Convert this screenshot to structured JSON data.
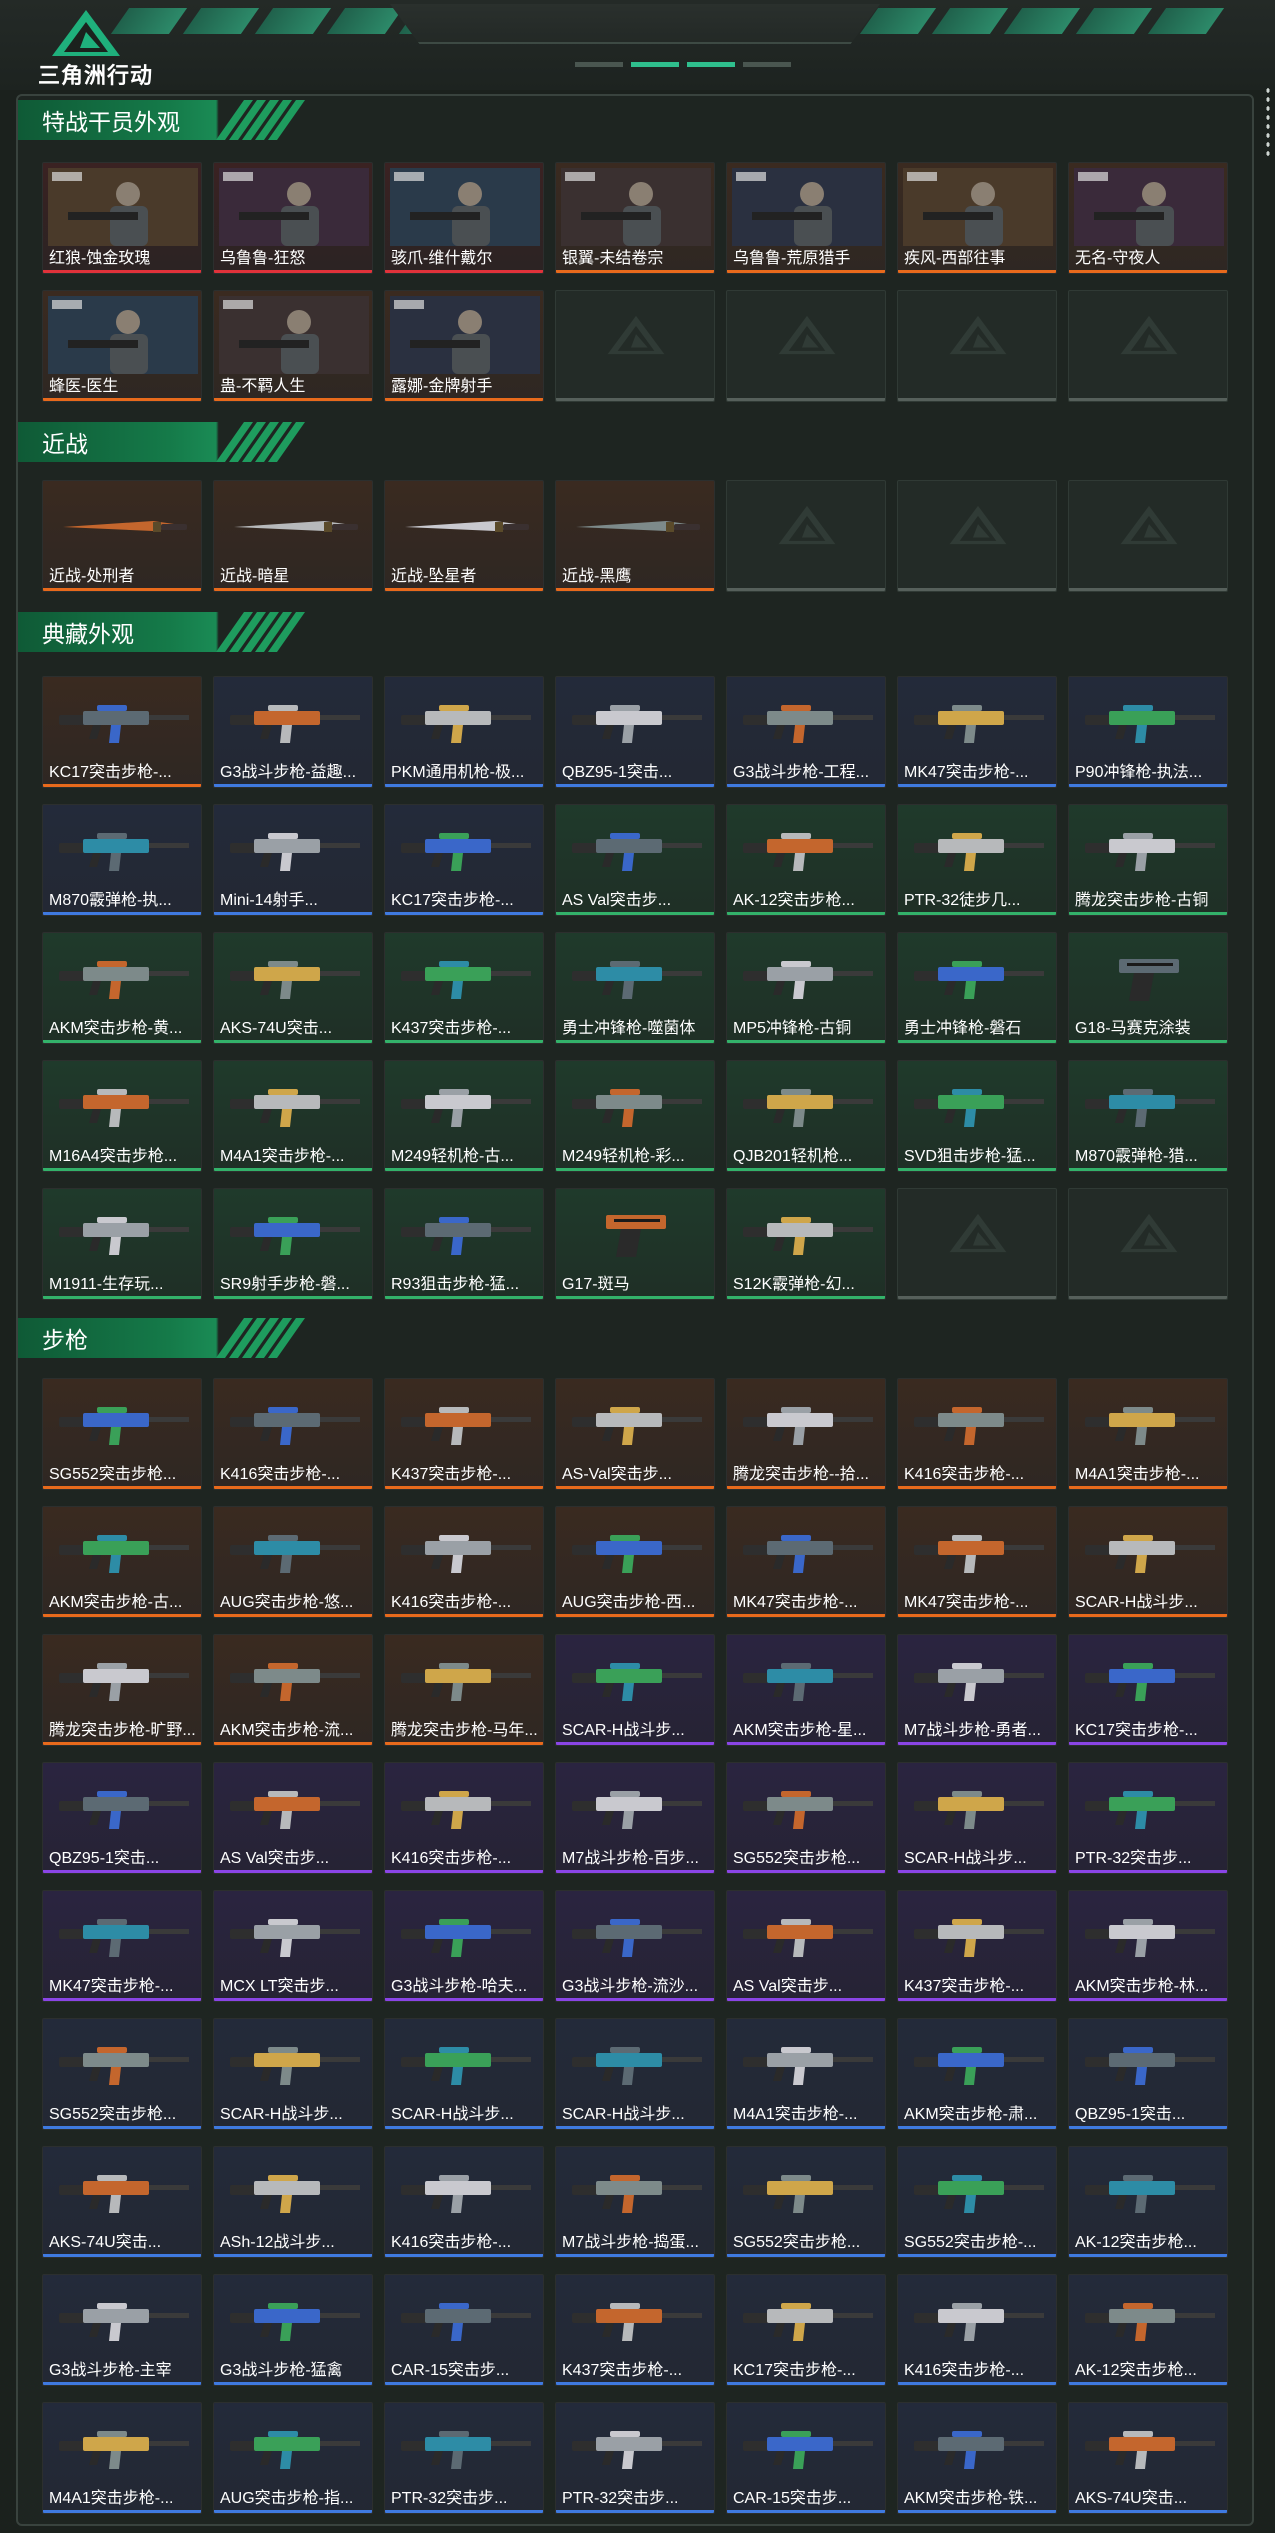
{
  "header": {
    "logo_text": "三角洲行动"
  },
  "colors": {
    "orange": "#e86a1c",
    "red": "#e0323a",
    "blue": "#3f7ae0",
    "purple": "#8a45e6",
    "green": "#33b26a",
    "accent": "#1a8b55"
  },
  "sections": [
    {
      "title": "特战干员外观",
      "items": [
        {
          "label": "红狼-蚀金玫瑰",
          "q": "red",
          "icon": "operator-portrait"
        },
        {
          "label": "乌鲁鲁-狂怒",
          "q": "red",
          "icon": "operator-portrait"
        },
        {
          "label": "骇爪-维什戴尔",
          "q": "red",
          "icon": "operator-portrait"
        },
        {
          "label": "银翼-未结卷宗",
          "q": "orange",
          "icon": "operator-portrait"
        },
        {
          "label": "乌鲁鲁-荒原猎手",
          "q": "orange",
          "icon": "operator-portrait"
        },
        {
          "label": "疾风-西部往事",
          "q": "orange",
          "icon": "operator-portrait"
        },
        {
          "label": "无名-守夜人",
          "q": "orange",
          "icon": "operator-portrait"
        },
        {
          "label": "蜂医-医生",
          "q": "orange",
          "icon": "operator-portrait"
        },
        {
          "label": "蛊-不羁人生",
          "q": "orange",
          "icon": "operator-portrait"
        },
        {
          "label": "露娜-金牌射手",
          "q": "orange",
          "icon": "operator-portrait"
        },
        {
          "label": "",
          "q": "empty"
        },
        {
          "label": "",
          "q": "empty"
        },
        {
          "label": "",
          "q": "empty"
        },
        {
          "label": "",
          "q": "empty"
        }
      ]
    },
    {
      "title": "近战",
      "items": [
        {
          "label": "近战-处刑者",
          "q": "orange",
          "icon": "melee-weapon"
        },
        {
          "label": "近战-暗星",
          "q": "orange",
          "icon": "melee-weapon"
        },
        {
          "label": "近战-坠星者",
          "q": "orange",
          "icon": "melee-weapon"
        },
        {
          "label": "近战-黑鹰",
          "q": "orange",
          "icon": "melee-weapon"
        },
        {
          "label": "",
          "q": "empty"
        },
        {
          "label": "",
          "q": "empty"
        },
        {
          "label": "",
          "q": "empty"
        }
      ]
    },
    {
      "title": "典藏外观",
      "items": [
        {
          "label": "KC17突击步枪-...",
          "q": "orange",
          "icon": "rifle"
        },
        {
          "label": "G3战斗步枪-益趣...",
          "q": "blue",
          "icon": "rifle"
        },
        {
          "label": "PKM通用机枪-极...",
          "q": "blue",
          "icon": "rifle"
        },
        {
          "label": "QBZ95-1突击...",
          "q": "blue",
          "icon": "rifle"
        },
        {
          "label": "G3战斗步枪-工程...",
          "q": "blue",
          "icon": "rifle"
        },
        {
          "label": "MK47突击步枪-...",
          "q": "blue",
          "icon": "rifle"
        },
        {
          "label": "P90冲锋枪-执法...",
          "q": "blue",
          "icon": "rifle"
        },
        {
          "label": "M870霰弹枪-执...",
          "q": "blue",
          "icon": "rifle"
        },
        {
          "label": "Mini-14射手...",
          "q": "blue",
          "icon": "rifle"
        },
        {
          "label": "KC17突击步枪-...",
          "q": "blue",
          "icon": "rifle"
        },
        {
          "label": "AS Val突击步...",
          "q": "green",
          "icon": "rifle"
        },
        {
          "label": "AK-12突击步枪...",
          "q": "green",
          "icon": "rifle"
        },
        {
          "label": "PTR-32徒步几...",
          "q": "green",
          "icon": "rifle"
        },
        {
          "label": "腾龙突击步枪-古铜",
          "q": "green",
          "icon": "rifle"
        },
        {
          "label": "AKM突击步枪-黄...",
          "q": "green",
          "icon": "rifle"
        },
        {
          "label": "AKS-74U突击...",
          "q": "green",
          "icon": "rifle"
        },
        {
          "label": "K437突击步枪-...",
          "q": "green",
          "icon": "rifle"
        },
        {
          "label": "勇士冲锋枪-噬菌体",
          "q": "green",
          "icon": "rifle"
        },
        {
          "label": "MP5冲锋枪-古铜",
          "q": "green",
          "icon": "rifle"
        },
        {
          "label": "勇士冲锋枪-磐石",
          "q": "green",
          "icon": "rifle"
        },
        {
          "label": "G18-马赛克涂装",
          "q": "green",
          "icon": "pistol"
        },
        {
          "label": "M16A4突击步枪...",
          "q": "green",
          "icon": "rifle"
        },
        {
          "label": "M4A1突击步枪-...",
          "q": "green",
          "icon": "rifle"
        },
        {
          "label": "M249轻机枪-古...",
          "q": "green",
          "icon": "rifle"
        },
        {
          "label": "M249轻机枪-彩...",
          "q": "green",
          "icon": "rifle"
        },
        {
          "label": "QJB201轻机枪...",
          "q": "green",
          "icon": "rifle"
        },
        {
          "label": "SVD狙击步枪-猛...",
          "q": "green",
          "icon": "rifle"
        },
        {
          "label": "M870霰弹枪-猎...",
          "q": "green",
          "icon": "rifle"
        },
        {
          "label": "M1911-生存玩...",
          "q": "green",
          "icon": "rifle"
        },
        {
          "label": "SR9射手步枪-磐...",
          "q": "green",
          "icon": "rifle"
        },
        {
          "label": "R93狙击步枪-猛...",
          "q": "green",
          "icon": "rifle"
        },
        {
          "label": "G17-斑马",
          "q": "green",
          "icon": "pistol"
        },
        {
          "label": "S12K霰弹枪-幻...",
          "q": "green",
          "icon": "rifle"
        },
        {
          "label": "",
          "q": "empty"
        },
        {
          "label": "",
          "q": "empty"
        }
      ]
    },
    {
      "title": "步枪",
      "items": [
        {
          "label": "SG552突击步枪...",
          "q": "orange",
          "icon": "rifle"
        },
        {
          "label": "K416突击步枪-...",
          "q": "orange",
          "icon": "rifle"
        },
        {
          "label": "K437突击步枪-...",
          "q": "orange",
          "icon": "rifle"
        },
        {
          "label": "AS-Val突击步...",
          "q": "orange",
          "icon": "rifle"
        },
        {
          "label": "腾龙突击步枪--拾...",
          "q": "orange",
          "icon": "rifle"
        },
        {
          "label": "K416突击步枪-...",
          "q": "orange",
          "icon": "rifle"
        },
        {
          "label": "M4A1突击步枪-...",
          "q": "orange",
          "icon": "rifle"
        },
        {
          "label": "AKM突击步枪-古...",
          "q": "orange",
          "icon": "rifle"
        },
        {
          "label": "AUG突击步枪-悠...",
          "q": "orange",
          "icon": "rifle"
        },
        {
          "label": "K416突击步枪-...",
          "q": "orange",
          "icon": "rifle"
        },
        {
          "label": "AUG突击步枪-西...",
          "q": "orange",
          "icon": "rifle"
        },
        {
          "label": "MK47突击步枪-...",
          "q": "orange",
          "icon": "rifle"
        },
        {
          "label": "MK47突击步枪-...",
          "q": "orange",
          "icon": "rifle"
        },
        {
          "label": "SCAR-H战斗步...",
          "q": "orange",
          "icon": "rifle"
        },
        {
          "label": "腾龙突击步枪-旷野...",
          "q": "orange",
          "icon": "rifle"
        },
        {
          "label": "AKM突击步枪-流...",
          "q": "orange",
          "icon": "rifle"
        },
        {
          "label": "腾龙突击步枪-马年...",
          "q": "orange",
          "icon": "rifle"
        },
        {
          "label": "SCAR-H战斗步...",
          "q": "purple",
          "icon": "rifle"
        },
        {
          "label": "AKM突击步枪-星...",
          "q": "purple",
          "icon": "rifle"
        },
        {
          "label": "M7战斗步枪-勇者...",
          "q": "purple",
          "icon": "rifle"
        },
        {
          "label": "KC17突击步枪-...",
          "q": "purple",
          "icon": "rifle"
        },
        {
          "label": "QBZ95-1突击...",
          "q": "purple",
          "icon": "rifle"
        },
        {
          "label": "AS Val突击步...",
          "q": "purple",
          "icon": "rifle"
        },
        {
          "label": "K416突击步枪-...",
          "q": "purple",
          "icon": "rifle"
        },
        {
          "label": "M7战斗步枪-百步...",
          "q": "purple",
          "icon": "rifle"
        },
        {
          "label": "SG552突击步枪...",
          "q": "purple",
          "icon": "rifle"
        },
        {
          "label": "SCAR-H战斗步...",
          "q": "purple",
          "icon": "rifle"
        },
        {
          "label": "PTR-32突击步...",
          "q": "purple",
          "icon": "rifle"
        },
        {
          "label": "MK47突击步枪-...",
          "q": "purple",
          "icon": "rifle"
        },
        {
          "label": "MCX LT突击步...",
          "q": "purple",
          "icon": "rifle"
        },
        {
          "label": "G3战斗步枪-哈夫...",
          "q": "purple",
          "icon": "rifle"
        },
        {
          "label": "G3战斗步枪-流沙...",
          "q": "purple",
          "icon": "rifle"
        },
        {
          "label": "AS Val突击步...",
          "q": "purple",
          "icon": "rifle"
        },
        {
          "label": "K437突击步枪-...",
          "q": "purple",
          "icon": "rifle"
        },
        {
          "label": "AKM突击步枪-林...",
          "q": "purple",
          "icon": "rifle"
        },
        {
          "label": "SG552突击步枪...",
          "q": "blue",
          "icon": "rifle"
        },
        {
          "label": "SCAR-H战斗步...",
          "q": "blue",
          "icon": "rifle"
        },
        {
          "label": "SCAR-H战斗步...",
          "q": "blue",
          "icon": "rifle"
        },
        {
          "label": "SCAR-H战斗步...",
          "q": "blue",
          "icon": "rifle"
        },
        {
          "label": "M4A1突击步枪-...",
          "q": "blue",
          "icon": "rifle"
        },
        {
          "label": "AKM突击步枪-肃...",
          "q": "blue",
          "icon": "rifle"
        },
        {
          "label": "QBZ95-1突击...",
          "q": "blue",
          "icon": "rifle"
        },
        {
          "label": "AKS-74U突击...",
          "q": "blue",
          "icon": "rifle"
        },
        {
          "label": "ASh-12战斗步...",
          "q": "blue",
          "icon": "rifle"
        },
        {
          "label": "K416突击步枪-...",
          "q": "blue",
          "icon": "rifle"
        },
        {
          "label": "M7战斗步枪-捣蛋...",
          "q": "blue",
          "icon": "rifle"
        },
        {
          "label": "SG552突击步枪...",
          "q": "blue",
          "icon": "rifle"
        },
        {
          "label": "SG552突击步枪-...",
          "q": "blue",
          "icon": "rifle"
        },
        {
          "label": "AK-12突击步枪...",
          "q": "blue",
          "icon": "rifle"
        },
        {
          "label": "G3战斗步枪-主宰",
          "q": "blue",
          "icon": "rifle"
        },
        {
          "label": "G3战斗步枪-猛禽",
          "q": "blue",
          "icon": "rifle"
        },
        {
          "label": "CAR-15突击步...",
          "q": "blue",
          "icon": "rifle"
        },
        {
          "label": "K437突击步枪-...",
          "q": "blue",
          "icon": "rifle"
        },
        {
          "label": "KC17突击步枪-...",
          "q": "blue",
          "icon": "rifle"
        },
        {
          "label": "K416突击步枪-...",
          "q": "blue",
          "icon": "rifle"
        },
        {
          "label": "AK-12突击步枪...",
          "q": "blue",
          "icon": "rifle"
        },
        {
          "label": "M4A1突击步枪-...",
          "q": "blue",
          "icon": "rifle"
        },
        {
          "label": "AUG突击步枪-指...",
          "q": "blue",
          "icon": "rifle"
        },
        {
          "label": "PTR-32突击步...",
          "q": "blue",
          "icon": "rifle"
        },
        {
          "label": "PTR-32突击步...",
          "q": "blue",
          "icon": "rifle"
        },
        {
          "label": "CAR-15突击步...",
          "q": "blue",
          "icon": "rifle"
        },
        {
          "label": "AKM突击步枪-铁...",
          "q": "blue",
          "icon": "rifle"
        },
        {
          "label": "AKS-74U突击...",
          "q": "blue",
          "icon": "rifle"
        }
      ]
    }
  ]
}
